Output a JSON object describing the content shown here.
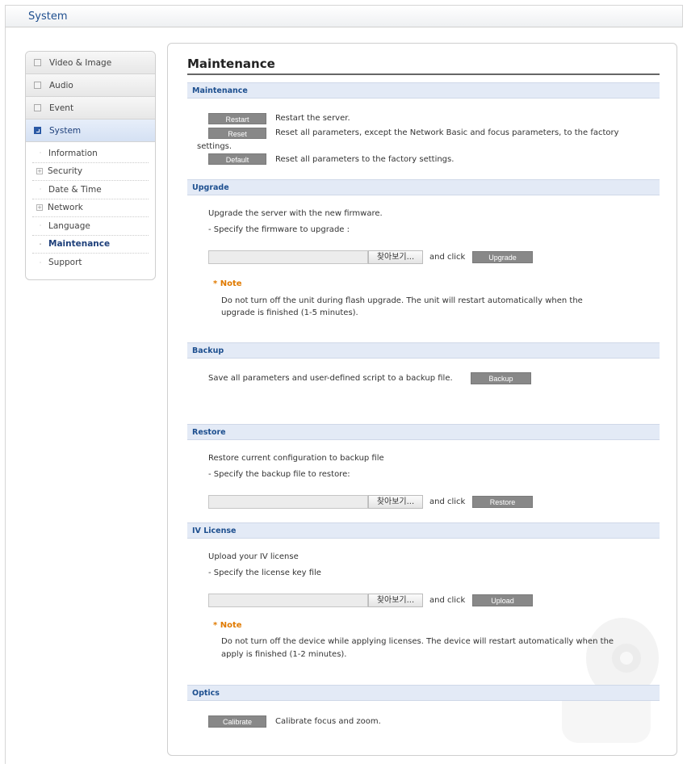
{
  "header": {
    "title": "System"
  },
  "sidebar": {
    "main_items": [
      {
        "label": "Video & Image"
      },
      {
        "label": "Audio"
      },
      {
        "label": "Event"
      },
      {
        "label": "System"
      }
    ],
    "sub_items": [
      {
        "label": "Information"
      },
      {
        "label": "Security"
      },
      {
        "label": "Date & Time"
      },
      {
        "label": "Network"
      },
      {
        "label": "Language"
      },
      {
        "label": "Maintenance"
      },
      {
        "label": "Support"
      }
    ]
  },
  "main": {
    "title": "Maintenance",
    "maintenance": {
      "heading": "Maintenance",
      "restart_label": "Restart",
      "restart_desc": "Restart the server.",
      "reset_label": "Reset",
      "reset_desc": "Reset all parameters, except the Network Basic and focus parameters, to the factory",
      "reset_desc_cont": "settings.",
      "default_label": "Default",
      "default_desc": "Reset all parameters to the factory settings."
    },
    "upgrade": {
      "heading": "Upgrade",
      "line1": "Upgrade the server with the new firmware.",
      "line2": "- Specify the firmware to upgrade :",
      "browse_label": "찾아보기...",
      "and_click": "and click",
      "button_label": "Upgrade",
      "note_title": "* Note",
      "note_line1": "Do not turn off the unit during flash upgrade. The unit will restart automatically when the",
      "note_line2": "upgrade is finished (1-5 minutes)."
    },
    "backup": {
      "heading": "Backup",
      "desc": "Save all parameters and user-defined script to a backup file.",
      "button_label": "Backup"
    },
    "restore": {
      "heading": "Restore",
      "line1": "Restore current configuration to backup file",
      "line2": "- Specify the backup file to restore:",
      "browse_label": "찾아보기...",
      "and_click": "and click",
      "button_label": "Restore"
    },
    "iv_license": {
      "heading": "IV License",
      "line1": "Upload your IV license",
      "line2": "- Specify the license key file",
      "browse_label": "찾아보기...",
      "and_click": "and click",
      "button_label": "Upload",
      "note_title": "* Note",
      "note_line1": "Do not turn off the device while applying licenses. The device will restart automatically when the",
      "note_line2": "apply is finished (1-2 minutes)."
    },
    "optics": {
      "heading": "Optics",
      "button_label": "Calibrate",
      "desc": "Calibrate focus and zoom."
    }
  },
  "colors": {
    "accent": "#1d4f8f",
    "section_bg": "#e3eaf6",
    "button_bg": "#888888",
    "note": "#e07a00"
  }
}
